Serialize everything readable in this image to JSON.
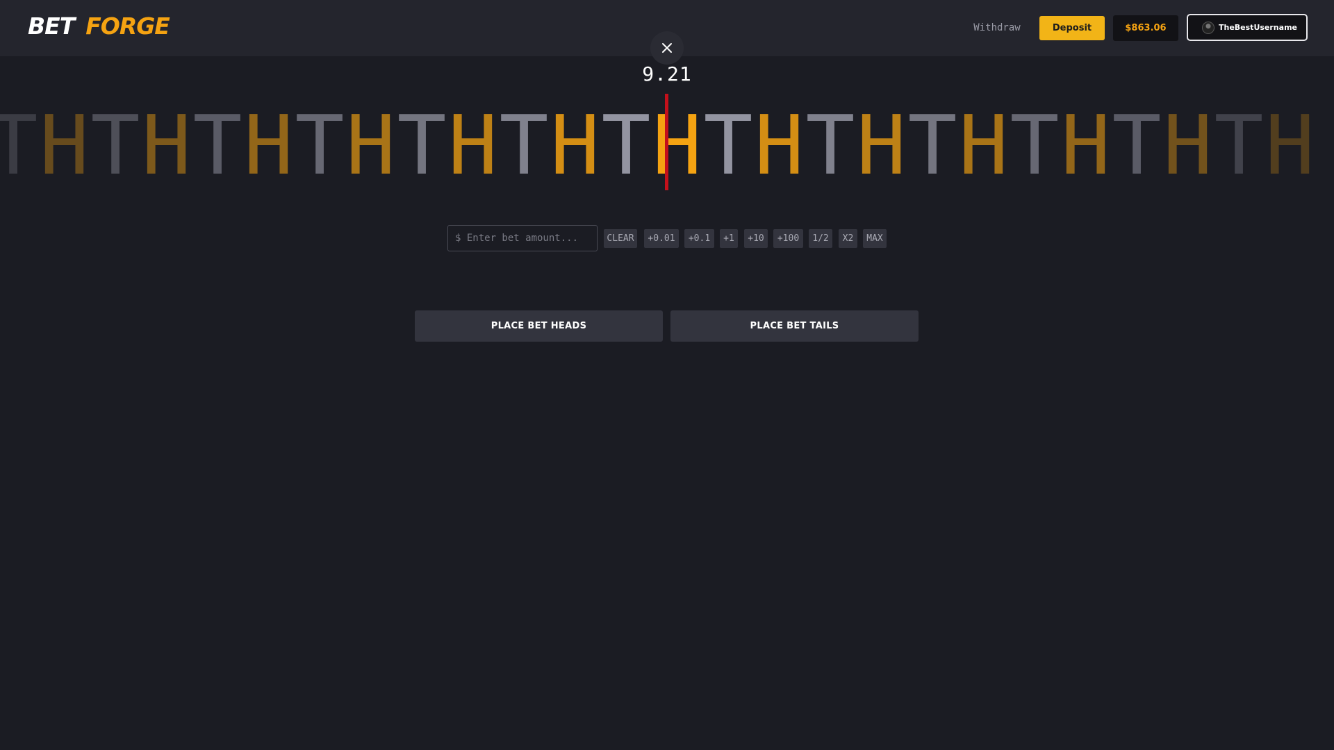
{
  "brand": {
    "part1": "BET",
    "part2": "FORGE"
  },
  "header": {
    "withdraw_label": "Withdraw",
    "deposit_label": "Deposit",
    "balance": "$863.06",
    "username": "TheBestUsername"
  },
  "game": {
    "multiplier": "9.21",
    "reel": [
      "T",
      "H",
      "T",
      "H",
      "T",
      "H",
      "T",
      "H",
      "T",
      "H",
      "T",
      "H",
      "T",
      "H",
      "T",
      "H",
      "T",
      "H",
      "T",
      "H",
      "T",
      "H",
      "T",
      "H",
      "T",
      "H"
    ],
    "reel_opacity": [
      0.25,
      0.35,
      0.4,
      0.45,
      0.5,
      0.55,
      0.6,
      0.65,
      0.7,
      0.75,
      0.8,
      0.85,
      0.95,
      1.0,
      0.95,
      0.85,
      0.8,
      0.75,
      0.7,
      0.65,
      0.6,
      0.55,
      0.5,
      0.4,
      0.3,
      0.25
    ]
  },
  "bet": {
    "input_placeholder": "$ Enter bet amount...",
    "quick_buttons": [
      "CLEAR",
      "+0.01",
      "+0.1",
      "+1",
      "+10",
      "+100",
      "1/2",
      "X2",
      "MAX"
    ]
  },
  "actions": {
    "heads_label": "PLACE BET HEADS",
    "tails_label": "PLACE BET TAILS"
  },
  "colors": {
    "heads": "#f5a312",
    "tails": "#9a9ba8",
    "marker": "#c4101b",
    "deposit": "#f2b417"
  }
}
